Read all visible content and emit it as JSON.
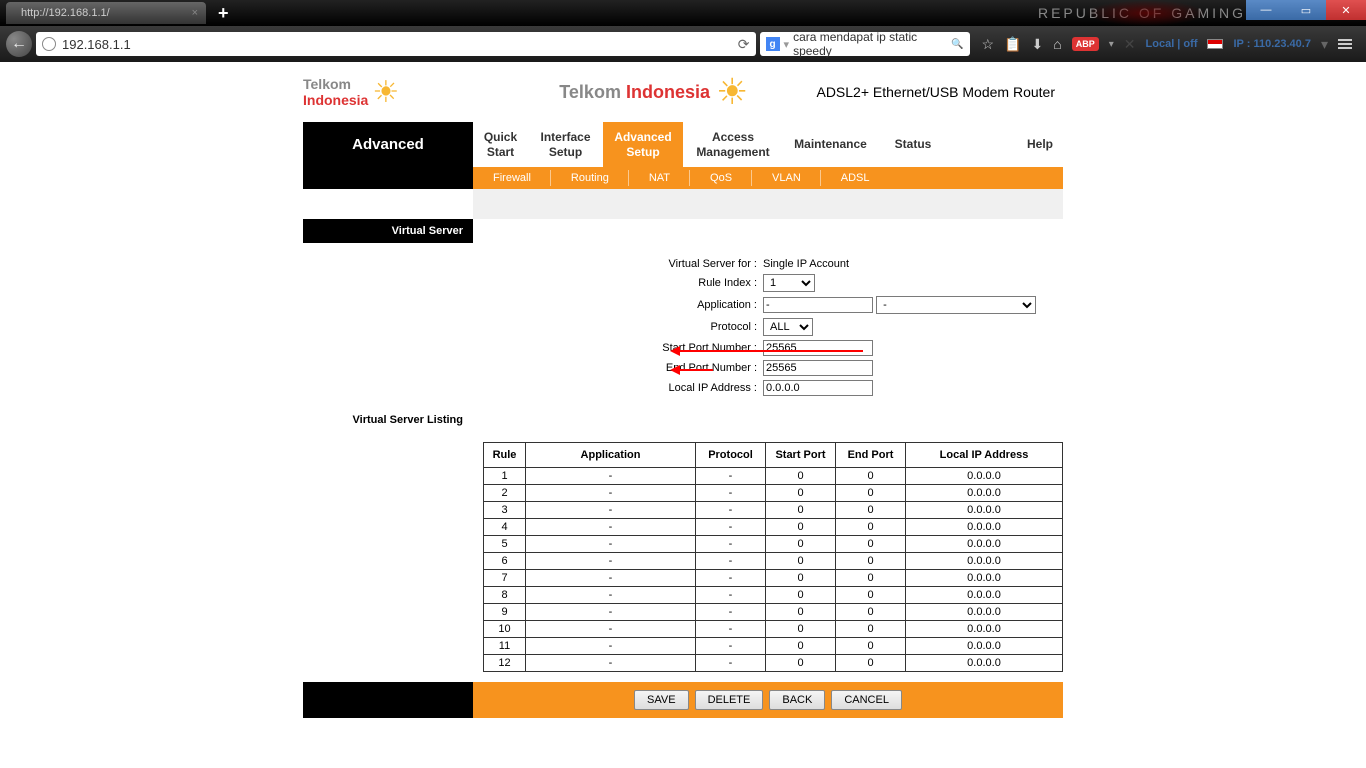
{
  "browser": {
    "tab_title": "http://192.168.1.1/",
    "url": "192.168.1.1",
    "search_text": "cara mendapat ip static speedy",
    "status": "Local | off",
    "ip_badge": "IP : 110.23.40.7"
  },
  "header": {
    "brand_small_1": "Telkom",
    "brand_small_2": "Indonesia",
    "brand_large_1": "Telkom",
    "brand_large_2": "Indonesia",
    "product": "ADSL2+ Ethernet/USB Modem Router",
    "current_section": "Advanced"
  },
  "main_tabs": {
    "quick": "Quick Start",
    "interface": "Interface Setup",
    "advanced": "Advanced Setup",
    "access": "Access Management",
    "maintenance": "Maintenance",
    "status": "Status",
    "help": "Help"
  },
  "sub_tabs": {
    "firewall": "Firewall",
    "routing": "Routing",
    "nat": "NAT",
    "qos": "QoS",
    "vlan": "VLAN",
    "adsl": "ADSL"
  },
  "section": {
    "virtual_server": "Virtual Server",
    "virtual_server_listing": "Virtual Server Listing"
  },
  "form": {
    "vs_for_label": "Virtual Server for :",
    "vs_for_value": "Single IP Account",
    "rule_index_label": "Rule Index :",
    "rule_index_value": "1",
    "application_label": "Application :",
    "application_value": "-",
    "application_preset": "-",
    "protocol_label": "Protocol :",
    "protocol_value": "ALL",
    "start_port_label": "Start Port Number :",
    "start_port_value": "25565",
    "end_port_label": "End Port Number :",
    "end_port_value": "25565",
    "local_ip_label": "Local IP Address :",
    "local_ip_value": "0.0.0.0"
  },
  "table": {
    "headers": {
      "rule": "Rule",
      "app": "Application",
      "proto": "Protocol",
      "sport": "Start Port",
      "eport": "End Port",
      "lip": "Local IP Address"
    },
    "rows": [
      {
        "rule": "1",
        "app": "-",
        "proto": "-",
        "sport": "0",
        "eport": "0",
        "lip": "0.0.0.0"
      },
      {
        "rule": "2",
        "app": "-",
        "proto": "-",
        "sport": "0",
        "eport": "0",
        "lip": "0.0.0.0"
      },
      {
        "rule": "3",
        "app": "-",
        "proto": "-",
        "sport": "0",
        "eport": "0",
        "lip": "0.0.0.0"
      },
      {
        "rule": "4",
        "app": "-",
        "proto": "-",
        "sport": "0",
        "eport": "0",
        "lip": "0.0.0.0"
      },
      {
        "rule": "5",
        "app": "-",
        "proto": "-",
        "sport": "0",
        "eport": "0",
        "lip": "0.0.0.0"
      },
      {
        "rule": "6",
        "app": "-",
        "proto": "-",
        "sport": "0",
        "eport": "0",
        "lip": "0.0.0.0"
      },
      {
        "rule": "7",
        "app": "-",
        "proto": "-",
        "sport": "0",
        "eport": "0",
        "lip": "0.0.0.0"
      },
      {
        "rule": "8",
        "app": "-",
        "proto": "-",
        "sport": "0",
        "eport": "0",
        "lip": "0.0.0.0"
      },
      {
        "rule": "9",
        "app": "-",
        "proto": "-",
        "sport": "0",
        "eport": "0",
        "lip": "0.0.0.0"
      },
      {
        "rule": "10",
        "app": "-",
        "proto": "-",
        "sport": "0",
        "eport": "0",
        "lip": "0.0.0.0"
      },
      {
        "rule": "11",
        "app": "-",
        "proto": "-",
        "sport": "0",
        "eport": "0",
        "lip": "0.0.0.0"
      },
      {
        "rule": "12",
        "app": "-",
        "proto": "-",
        "sport": "0",
        "eport": "0",
        "lip": "0.0.0.0"
      }
    ]
  },
  "buttons": {
    "save": "SAVE",
    "delete": "DELETE",
    "back": "BACK",
    "cancel": "CANCEL"
  },
  "rog": "REPUBLIC OF GAMING"
}
